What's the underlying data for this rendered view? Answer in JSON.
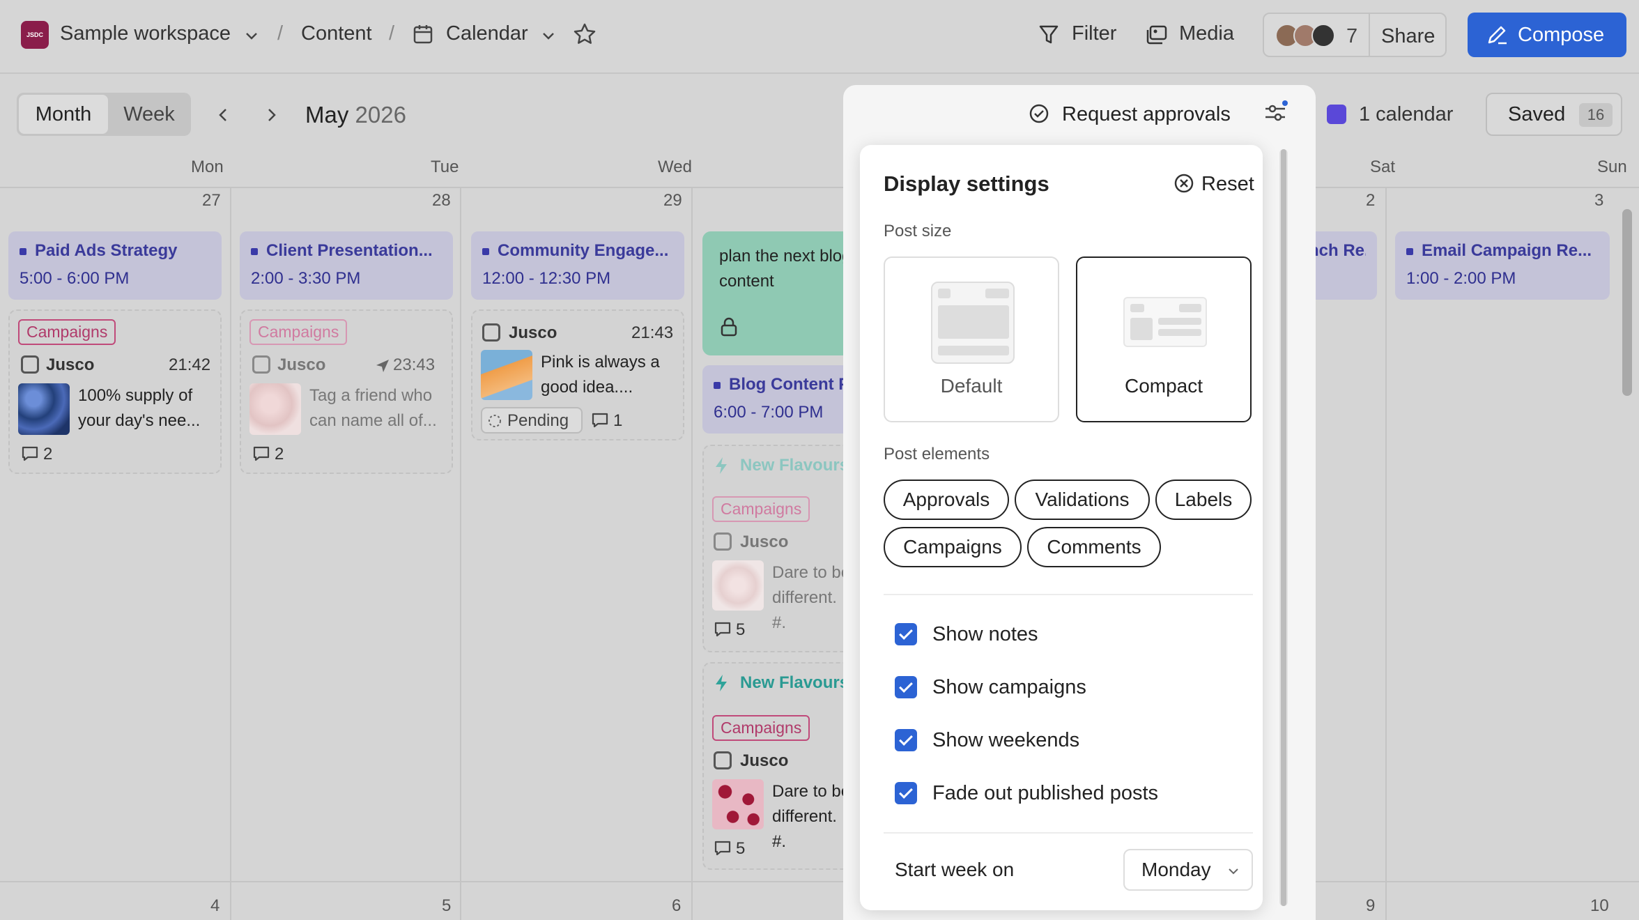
{
  "header": {
    "workspace": "Sample workspace",
    "workspace_logo": "JSDC",
    "breadcrumb_content": "Content",
    "breadcrumb_calendar": "Calendar",
    "filter_label": "Filter",
    "media_label": "Media",
    "members_count": "7",
    "share_label": "Share",
    "compose_label": "Compose"
  },
  "toolbar": {
    "view_month": "Month",
    "view_week": "Week",
    "month": "May",
    "year": "2026",
    "request_approvals": "Request approvals",
    "calendars": "1 calendar",
    "saved_label": "Saved",
    "saved_count": "16"
  },
  "days": [
    "Mon",
    "Tue",
    "Wed",
    "Sat",
    "Sun"
  ],
  "day_numbers": {
    "mon1": "27",
    "tue1": "28",
    "wed1": "29",
    "sat1": "2",
    "sun1": "3",
    "mon2": "4",
    "tue2": "5",
    "wed2": "6",
    "sat2": "9",
    "sun2": "10"
  },
  "events": {
    "e1_title": "Paid Ads Strategy",
    "e1_time": "5:00 - 6:00 PM",
    "e2_title": "Client Presentation...",
    "e2_time": "2:00 - 3:30 PM",
    "e3_title": "Community Engage...",
    "e3_time": "12:00 - 12:30 PM",
    "e4_title": "Blog Content Pla",
    "e4_time": "6:00 - 7:00 PM",
    "e5_title": "nch Re...",
    "e6_title": "Email Campaign Re...",
    "e6_time": "1:00 - 2:00 PM"
  },
  "note": {
    "text1": "plan the next blog",
    "text2": "content"
  },
  "posts": {
    "p1_tag": "Campaigns",
    "p1_account": "Jusco",
    "p1_time": "21:42",
    "p1_text1": "100% supply of",
    "p1_text2": "your day's nee...",
    "p1_comments": "2",
    "p2_tag": "Campaigns",
    "p2_account": "Jusco",
    "p2_time": "23:43",
    "p2_text1": "Tag a friend who",
    "p2_text2": "can name all of...",
    "p2_comments": "2",
    "p3_account": "Jusco",
    "p3_time": "21:43",
    "p3_text1": "Pink is always a",
    "p3_text2": "good idea....",
    "p3_status": "Pending",
    "p3_comments": "1",
    "p4_title": "New Flavours L",
    "p4_tag": "Campaigns",
    "p4_account": "Jusco",
    "p4_text1": "Dare to be",
    "p4_text2": "different. #.",
    "p4_comments": "5",
    "p5_title": "New Flavours L",
    "p5_tag": "Campaigns",
    "p5_account": "Jusco",
    "p5_text1": "Dare to be",
    "p5_text2": "different. #.",
    "p5_comments": "5"
  },
  "display_settings": {
    "title": "Display settings",
    "reset_label": "Reset",
    "post_size_label": "Post size",
    "size_default": "Default",
    "size_compact": "Compact",
    "selected_size": "Compact",
    "post_elements_label": "Post elements",
    "chip_approvals": "Approvals",
    "chip_validations": "Validations",
    "chip_labels": "Labels",
    "chip_campaigns": "Campaigns",
    "chip_comments": "Comments",
    "show_notes": "Show notes",
    "show_campaigns": "Show campaigns",
    "show_weekends": "Show weekends",
    "fade_published": "Fade out published posts",
    "start_week_label": "Start week on",
    "start_week_value": "Monday"
  },
  "colors": {
    "accent": "#2c63d4",
    "calendar_color": "#5a48d8",
    "event_bg": "#c4c3d8",
    "note_bg": "#8fc9b3",
    "campaign_tag": "#c04a7a"
  }
}
